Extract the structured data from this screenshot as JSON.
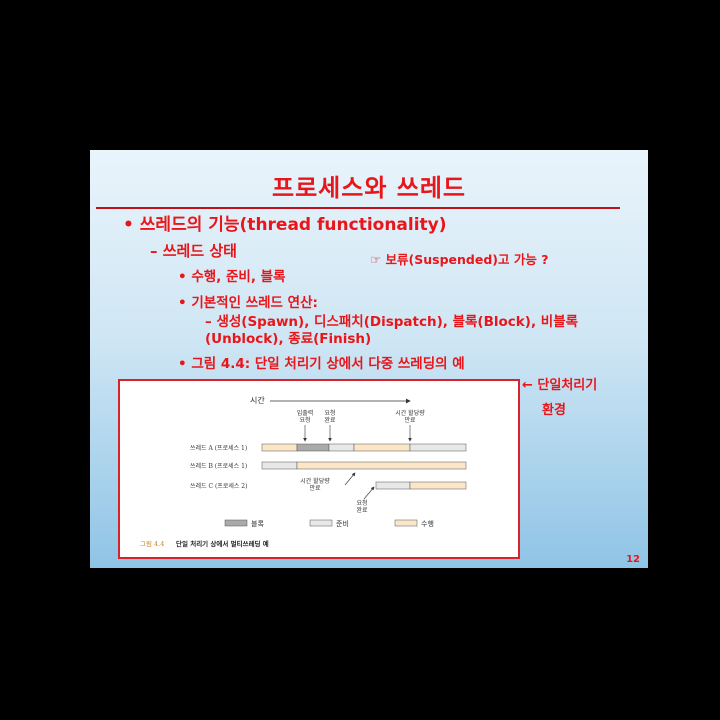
{
  "slide": {
    "title": "프로세스와 쓰레드",
    "bullet1": "• 쓰레드의 기능(thread functionality)",
    "bullet2": "– 쓰레드 상태",
    "note": "☞ 보류(Suspended)고 가능 ?",
    "bullet3a": "• 수행, 준비, 블록",
    "bullet3b": "• 기본적인 쓰레드 연산:",
    "bullet4": "– 생성(Spawn), 디스패치(Dispatch), 블록(Block), 비블록(Unblock), 종료(Finish)",
    "bullet3c": "• 그림 4.4: 단일 처리기 상에서 다중 쓰레딩의 예",
    "side_note_line1": "← 단일처리기",
    "side_note_line2": "환경",
    "page_number": "12"
  },
  "figure": {
    "time_label": "시간",
    "annotation_io": [
      "입출력",
      "요청"
    ],
    "annotation_req": [
      "요청",
      "완료"
    ],
    "annotation_quantum_top": [
      "시간 할당량",
      "만료"
    ],
    "annotation_quantum_mid": [
      "시간 할당량",
      "만료"
    ],
    "annotation_req_bottom": [
      "요청",
      "완료"
    ],
    "threads": [
      "쓰레드 A (프로세스 1)",
      "쓰레드 B (프로세스 1)",
      "쓰레드 C (프로세스 2)"
    ],
    "legend": [
      "블록",
      "준비",
      "수행"
    ],
    "caption_num": "그림 4.4",
    "caption_text": "단일 처리기 상에서 멀티쓰레딩 예"
  },
  "colors": {
    "accent": "#e8161a",
    "run": "#fbe6c8",
    "blocked": "#aaaaaa",
    "ready": "#e8e8e8"
  }
}
